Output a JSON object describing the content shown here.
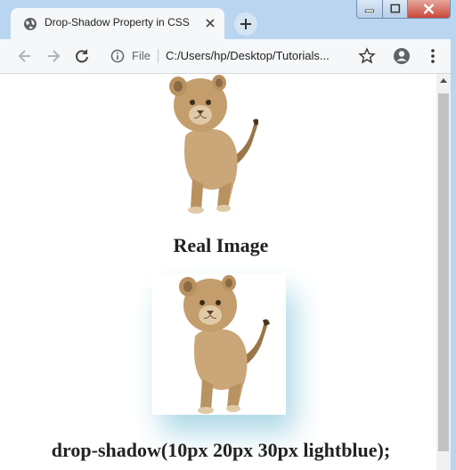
{
  "browser": {
    "tab_title": "Drop-Shadow Property in CSS",
    "omnibox": {
      "scheme_label": "File",
      "url": "C:/Users/hp/Desktop/Tutorials..."
    }
  },
  "page": {
    "caption_real": "Real Image",
    "caption_shadow": "drop-shadow(10px 20px 30px lightblue);"
  },
  "colors": {
    "shadow": "#add8e6"
  }
}
